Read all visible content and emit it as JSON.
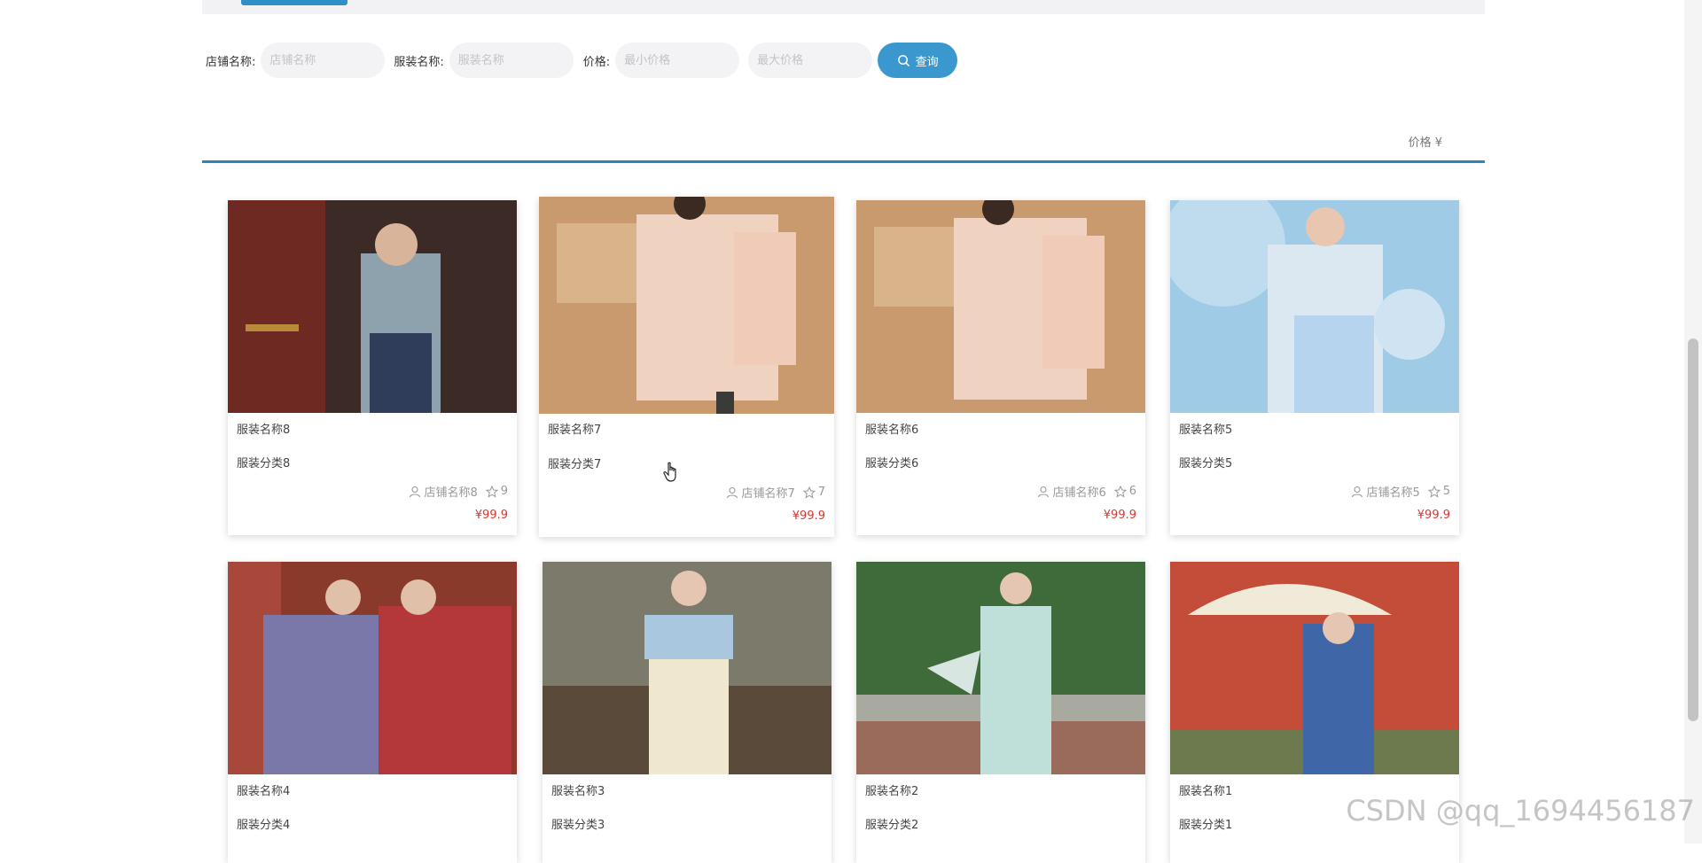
{
  "search": {
    "shop_label": "店铺名称:",
    "shop_placeholder": "店铺名称",
    "name_label": "服装名称:",
    "name_placeholder": "服装名称",
    "price_label": "价格:",
    "min_placeholder": "最小价格",
    "max_placeholder": "最大价格",
    "query_label": "查询"
  },
  "sort": {
    "price_label": "价格 ¥"
  },
  "products": [
    {
      "name": "服装名称8",
      "category": "服装分类8",
      "shop": "店铺名称8",
      "favorites": "9",
      "price": "¥99.9"
    },
    {
      "name": "服装名称7",
      "category": "服装分类7",
      "shop": "店铺名称7",
      "favorites": "7",
      "price": "¥99.9"
    },
    {
      "name": "服装名称6",
      "category": "服装分类6",
      "shop": "店铺名称6",
      "favorites": "6",
      "price": "¥99.9"
    },
    {
      "name": "服装名称5",
      "category": "服装分类5",
      "shop": "店铺名称5",
      "favorites": "5",
      "price": "¥99.9"
    },
    {
      "name": "服装名称4",
      "category": "服装分类4"
    },
    {
      "name": "服装名称3",
      "category": "服装分类3"
    },
    {
      "name": "服装名称2",
      "category": "服装分类2"
    },
    {
      "name": "服装名称1",
      "category": "服装分类1"
    }
  ],
  "watermark": "CSDN @qq_1694456187",
  "colors": {
    "accent": "#3a98cf",
    "price": "#d9362e",
    "divider": "#2b86b8"
  }
}
